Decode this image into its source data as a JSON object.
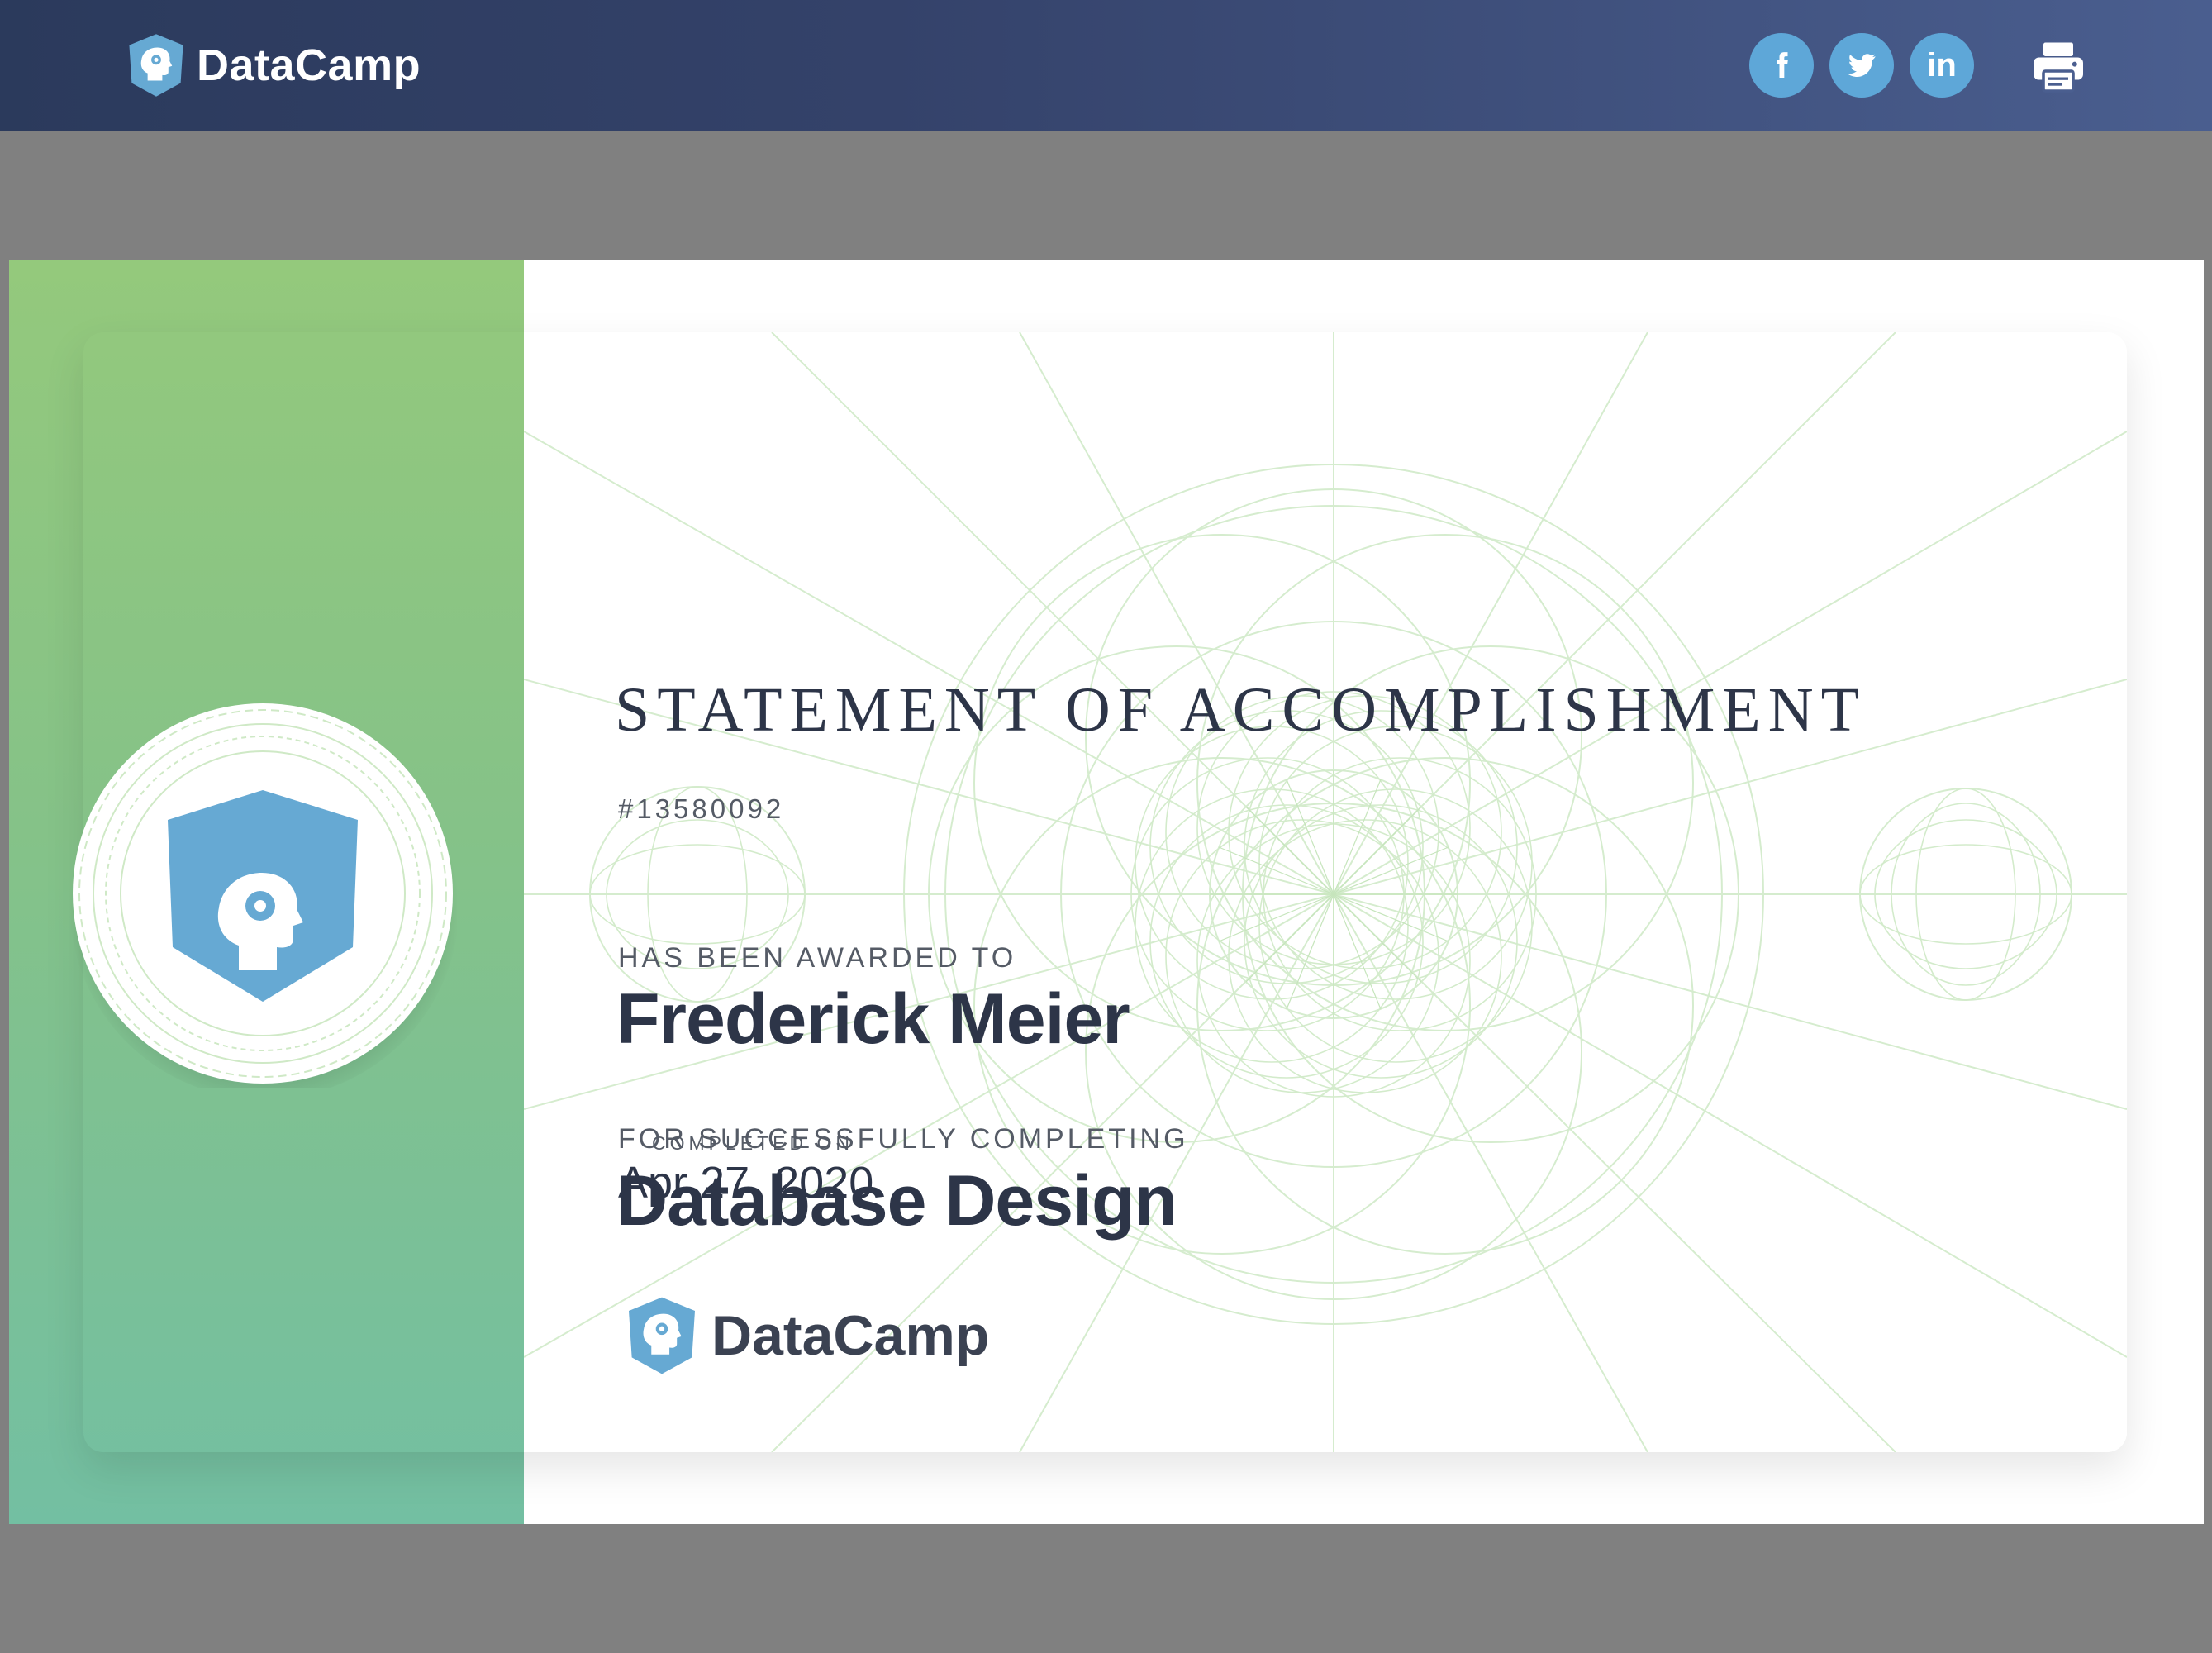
{
  "header": {
    "brand_name": "DataCamp",
    "logo_icon": "datacamp-hexagon-head-icon",
    "share": [
      {
        "label": "f",
        "icon": "facebook-icon"
      },
      {
        "label": "twitter",
        "icon": "twitter-icon"
      },
      {
        "label": "in",
        "icon": "linkedin-icon"
      }
    ],
    "print_icon": "printer-icon"
  },
  "certificate": {
    "title": "STATEMENT OF ACCOMPLISHMENT",
    "id": "#13580092",
    "awarded_label": "HAS BEEN AWARDED TO",
    "recipient": "Frederick Meier",
    "completing_label": "FOR SUCCESSFULLY COMPLETING",
    "course": "Database Design",
    "completed_label": "COMPLETED ON",
    "completed_date": "Apr 27, 2020",
    "footer_brand": "DataCamp"
  },
  "colors": {
    "header_dark": "#2b3a5c",
    "header_light": "#4a5e8f",
    "share_blue": "#5ea7d8",
    "sidebar_top": "#94c97c",
    "sidebar_bottom": "#73bfa2",
    "logo_blue": "#66a9d3",
    "text_dark": "#2d3548",
    "guilloche_green": "#cfe9c6"
  }
}
